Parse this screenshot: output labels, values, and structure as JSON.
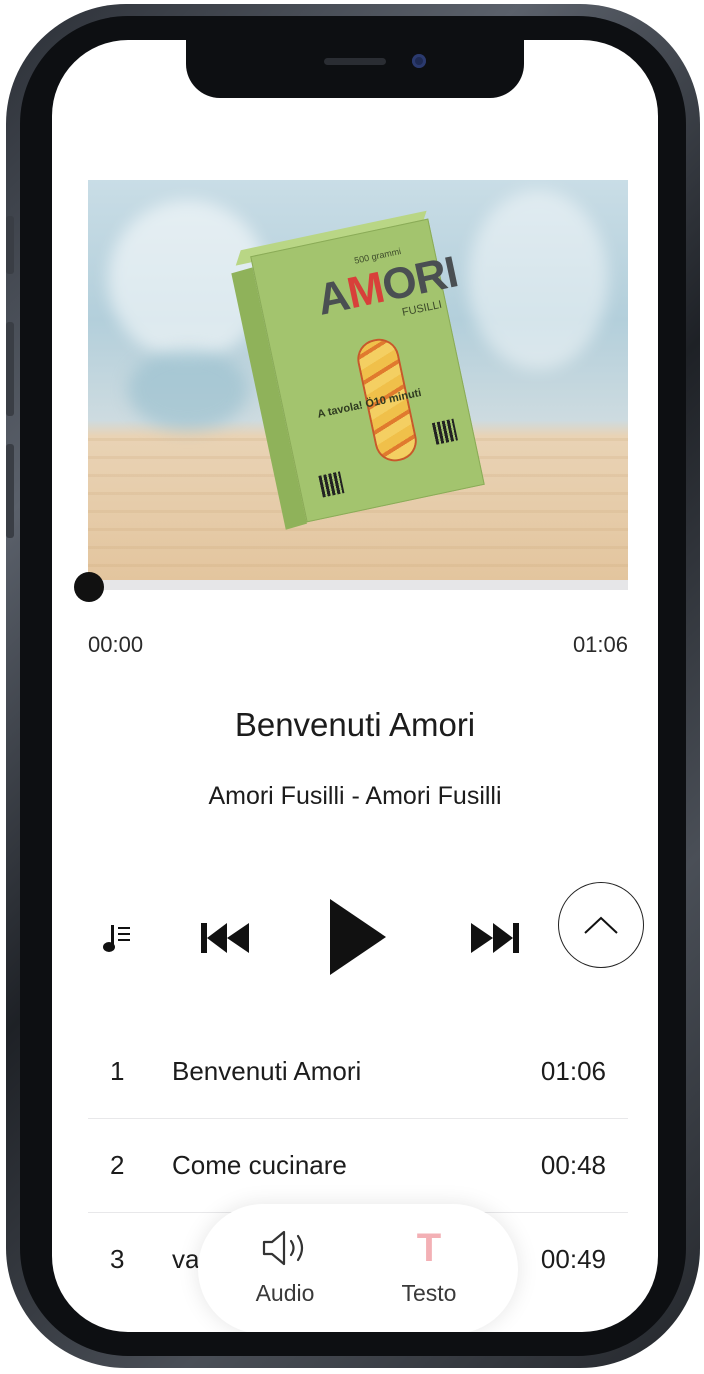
{
  "player": {
    "current_time": "00:00",
    "total_time": "01:06",
    "progress": 0.0,
    "title": "Benvenuti Amori",
    "subtitle": "Amori Fusilli - Amori Fusilli"
  },
  "cover": {
    "brand_small": "500 grammi",
    "brand_prefix": "A",
    "brand_heart": "M",
    "brand_suffix": "ORI",
    "brand_sub": "FUSILLI",
    "tag": "A tavola! Ö10 minuti"
  },
  "controls": {
    "icons": [
      "playlist-icon",
      "skip-back-icon",
      "play-icon",
      "skip-forward-icon",
      "chevron-up-icon"
    ]
  },
  "tracks": [
    {
      "num": "1",
      "name": "Benvenuti Amori",
      "duration": "01:06"
    },
    {
      "num": "2",
      "name": "Come cucinare",
      "duration": "00:48"
    },
    {
      "num": "3",
      "name": "va",
      "duration": "00:49"
    }
  ],
  "tabbar": {
    "audio_label": "Audio",
    "testo_label": "Testo",
    "testo_glyph": "T",
    "testo_color": "#f3b0b5"
  }
}
